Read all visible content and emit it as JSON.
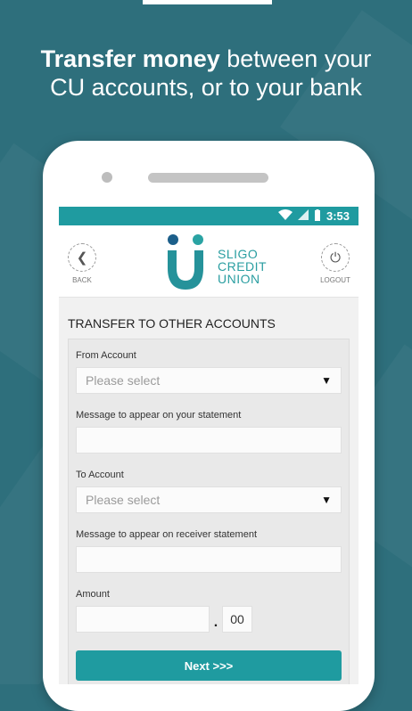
{
  "headline": {
    "bold": "Transfer money",
    "line1_rest": " between your",
    "line2": "CU accounts, or to your bank"
  },
  "statusbar": {
    "time": "3:53"
  },
  "appbar": {
    "back_label": "BACK",
    "logout_label": "LOGOUT",
    "logo_lines": [
      "SLIGO",
      "CREDIT",
      "UNION"
    ]
  },
  "form": {
    "title": "TRANSFER TO OTHER ACCOUNTS",
    "from_account_label": "From Account",
    "from_account_value": "Please select",
    "statement_msg_label": "Message to appear on your statement",
    "to_account_label": "To Account",
    "to_account_value": "Please select",
    "receiver_msg_label": "Message to appear on receiver statement",
    "amount_label": "Amount",
    "amount_cents": "00",
    "next_label": "Next >>>"
  },
  "colors": {
    "accent": "#1f9ba0",
    "background": "#2e6f7c"
  }
}
